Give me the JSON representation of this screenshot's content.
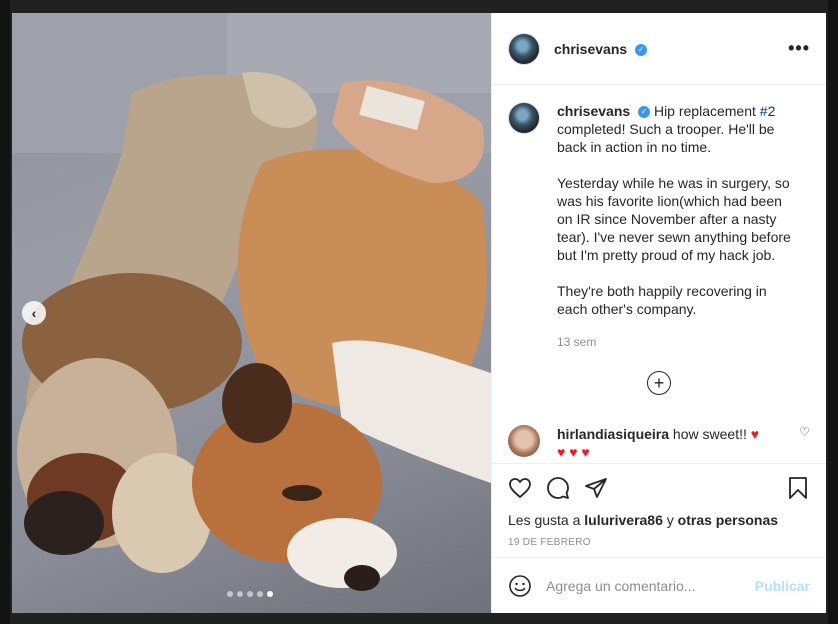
{
  "post": {
    "username": "chrisevans",
    "more_icon": "more-horizontal-icon"
  },
  "caption": {
    "username": "chrisevans",
    "line1_a": "Hip replacement ",
    "hashtag": "#2",
    "line1_b": " completed! Such a trooper. He'll be back in action in no time.",
    "para2": "Yesterday while he was in surgery, so was his favorite lion(which had been on IR since November after a nasty tear). I've never sewn anything before but I'm pretty proud of my hack job.",
    "para3": "They're both happily recovering in each other's company.",
    "time": "13 sem"
  },
  "comment": {
    "username": "hirlandiasiqueira",
    "text": " how sweet!!",
    "hearts": "♥ ♥ ♥"
  },
  "likes": {
    "prefix": "Les gusta a ",
    "user": "lulurivera86",
    "middle": " y ",
    "others": "otras personas"
  },
  "date": "19 DE FEBRERO",
  "add_comment": {
    "placeholder": "Agrega un comentario...",
    "publish": "Publicar"
  },
  "carousel": {
    "count": 5,
    "active": 5
  },
  "colors": {
    "accent": "#3897f0",
    "publish_disabled": "#b2dffc",
    "heart_red": "#ed1c24"
  }
}
